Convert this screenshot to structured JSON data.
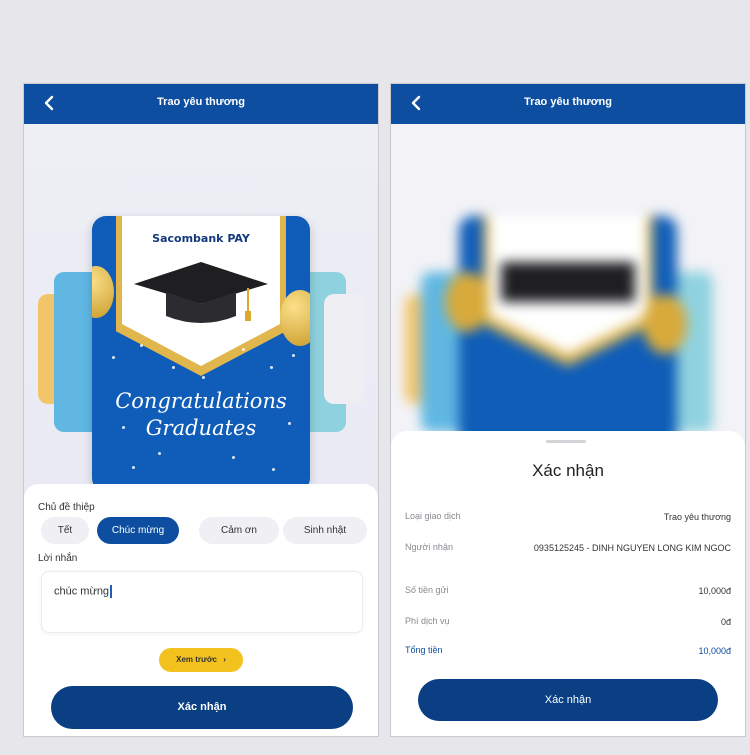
{
  "left_screen": {
    "header": {
      "title": "Trao yêu thương"
    },
    "card": {
      "brand": "Sacombank PAY",
      "line1": "Congratulations",
      "line2": "Graduates"
    },
    "form": {
      "theme_label": "Chủ đề thiệp",
      "chips": [
        "Tết",
        "Chúc mừng",
        "Cảm ơn",
        "Sinh nhật"
      ],
      "selected_chip": "Chúc mừng",
      "message_label": "Lời nhắn",
      "message_value": "chúc mừng",
      "preview_label": "Xem trước",
      "confirm_label": "Xác nhận"
    }
  },
  "right_screen": {
    "header": {
      "title": "Trao yêu thương"
    },
    "sheet": {
      "title": "Xác nhận",
      "rows": [
        {
          "label": "Loại giao dịch",
          "value": "Trao yêu thương"
        },
        {
          "label": "Người nhận",
          "value": "0935125245 - DINH NGUYEN LONG KIM NGOC"
        },
        {
          "label": "Số tiền gửi",
          "value": "10,000đ"
        },
        {
          "label": "Phí dịch vụ",
          "value": "0đ"
        },
        {
          "label": "Tổng tiền",
          "value": "10,000đ"
        }
      ],
      "confirm_label": "Xác nhận"
    }
  },
  "colors": {
    "primary": "#0d4ea0",
    "button_dark": "#0a3f84",
    "preview_yellow": "#f4c21f",
    "card_blue": "#0f5db8",
    "gold": "#e1b64c"
  }
}
